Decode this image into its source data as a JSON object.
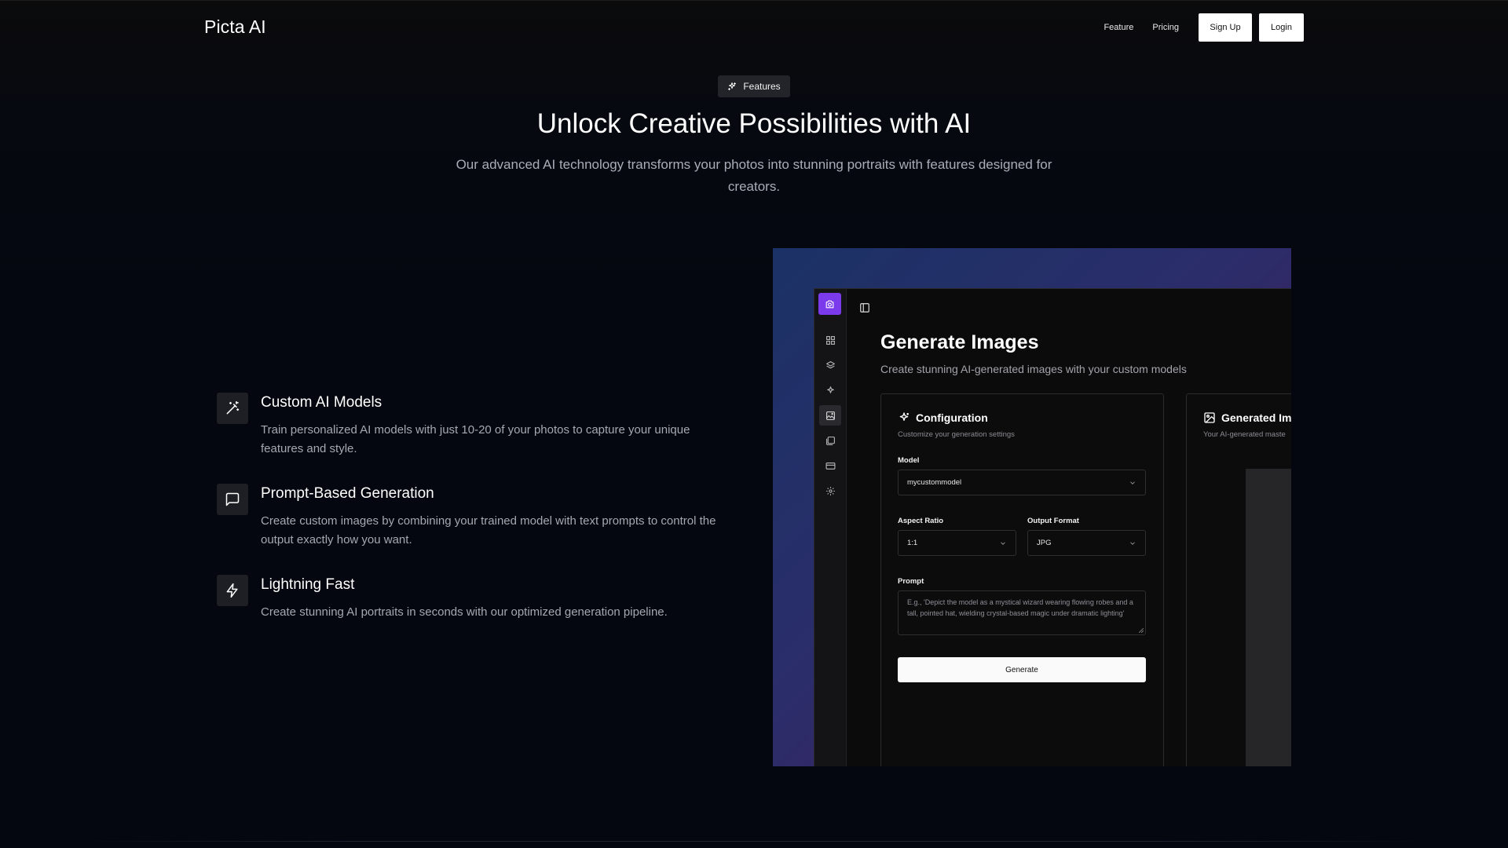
{
  "nav": {
    "brand": "Picta AI",
    "links": [
      "Feature",
      "Pricing"
    ],
    "signup_label": "Sign Up",
    "login_label": "Login"
  },
  "hero": {
    "badge": "Features",
    "title": "Unlock Creative Possibilities with AI",
    "subtitle": "Our advanced AI technology transforms your photos into stunning portraits with features designed for creators."
  },
  "features": [
    {
      "icon": "magic-wand-icon",
      "title": "Custom AI Models",
      "desc": "Train personalized AI models with just 10-20 of your photos to capture your unique features and style."
    },
    {
      "icon": "message-square-icon",
      "title": "Prompt-Based Generation",
      "desc": "Create custom images by combining your trained model with text prompts to control the output exactly how you want."
    },
    {
      "icon": "zap-icon",
      "title": "Lightning Fast",
      "desc": "Create stunning AI portraits in seconds with our optimized generation pipeline."
    }
  ],
  "preview": {
    "title": "Generate Images",
    "subtitle": "Create stunning AI-generated images with your custom models",
    "config": {
      "title": "Configuration",
      "subtitle": "Customize your generation settings",
      "model_label": "Model",
      "model_value": "mycustommodel",
      "aspect_label": "Aspect Ratio",
      "aspect_value": "1:1",
      "format_label": "Output Format",
      "format_value": "JPG",
      "prompt_label": "Prompt",
      "prompt_placeholder": "E.g., 'Depict the model as a mystical wizard wearing flowing robes and a tall, pointed hat, wielding crystal-based magic under dramatic lighting'",
      "generate_label": "Generate"
    },
    "result": {
      "title": "Generated Im",
      "subtitle": "Your AI-generated maste"
    }
  },
  "colors": {
    "accent": "#7c3aed",
    "background": "#04070f"
  }
}
